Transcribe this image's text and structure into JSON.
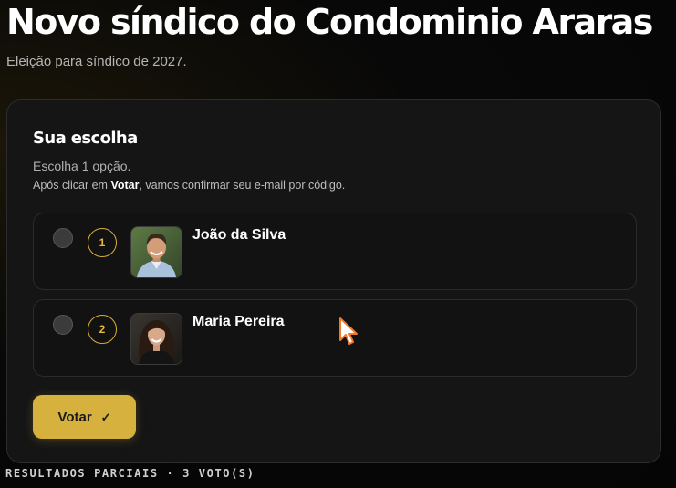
{
  "header": {
    "title": "Novo síndico do Condominio Araras",
    "subtitle": "Eleição para síndico de 2027."
  },
  "ballot": {
    "title": "Sua escolha",
    "hint": "Escolha 1 opção.",
    "note_before": "Após clicar em ",
    "note_bold": "Votar",
    "note_after": ", vamos confirmar seu e-mail por código.",
    "options": [
      {
        "number": "1",
        "name": "João da Silva",
        "selected": false,
        "avatar": "man-portrait"
      },
      {
        "number": "2",
        "name": "Maria Pereira",
        "selected": false,
        "avatar": "woman-portrait"
      }
    ],
    "vote_label": "Votar",
    "vote_icon": "check-icon"
  },
  "results": {
    "label": "RESULTADOS PARCIAIS · 3 VOTO(S)"
  },
  "colors": {
    "accent": "#d7b13d",
    "background": "#080808",
    "card": "#151515"
  }
}
